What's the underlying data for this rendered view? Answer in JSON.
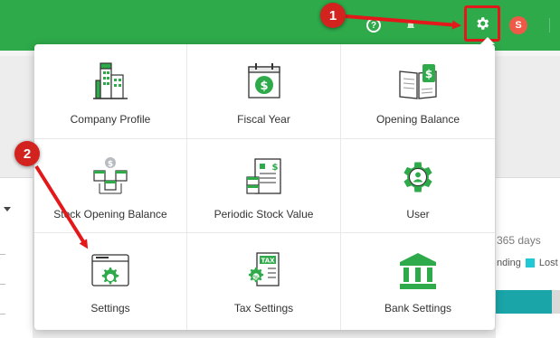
{
  "header": {
    "help_icon": "question-circle-icon",
    "settings_icon": "gear-icon",
    "avatar_initial": "S",
    "avatar_color": "#ef5a48",
    "brand_color": "#2eaa4a"
  },
  "menu": {
    "items": [
      {
        "label": "Company Profile",
        "icon": "building-icon"
      },
      {
        "label": "Fiscal Year",
        "icon": "calendar-dollar-icon"
      },
      {
        "label": "Opening Balance",
        "icon": "ledger-book-icon"
      },
      {
        "label": "Stock Opening Balance",
        "icon": "stock-boxes-icon"
      },
      {
        "label": "Periodic Stock Value",
        "icon": "stock-report-icon"
      },
      {
        "label": "User",
        "icon": "user-gear-icon"
      },
      {
        "label": "Settings",
        "icon": "settings-window-icon"
      },
      {
        "label": "Tax Settings",
        "icon": "tax-document-icon"
      },
      {
        "label": "Bank Settings",
        "icon": "bank-icon"
      }
    ]
  },
  "callouts": {
    "first": "1",
    "second": "2"
  },
  "background": {
    "days_text": "365 days",
    "legend_pending": "nding",
    "legend_lost": "Lost",
    "teal": "#1aa5a8",
    "cyan": "#1ec8d4"
  },
  "accent_red": "#e3181b"
}
